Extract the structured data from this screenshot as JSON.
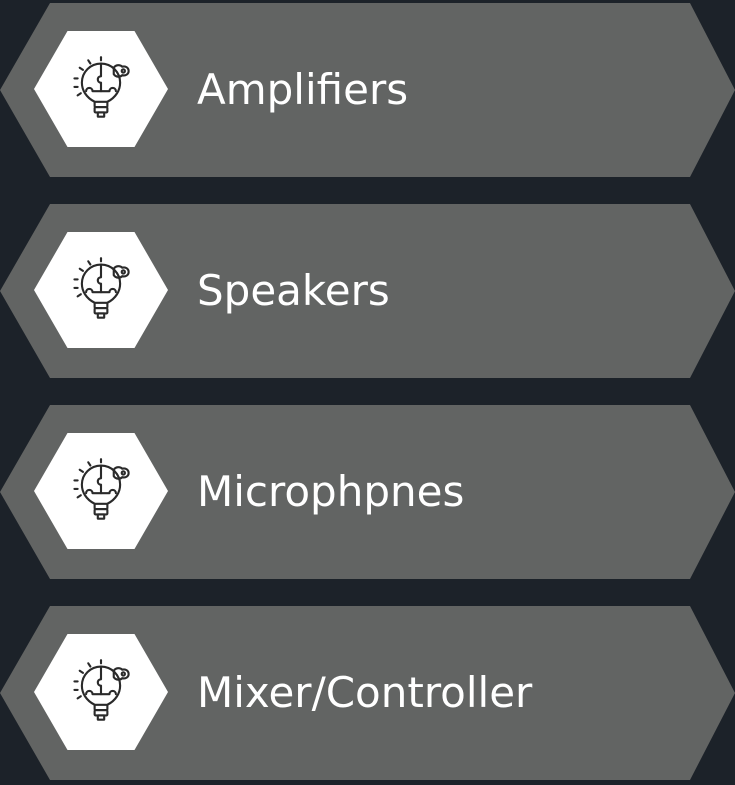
{
  "colors": {
    "background": "#1c2229",
    "panel": "#626463",
    "panel_edge": "#4f5250",
    "hex": "#ffffff",
    "icon": "#2a2a2a",
    "text": "#ffffff"
  },
  "items": [
    {
      "label": "Amplifiers",
      "icon": "lightbulb-puzzle-icon"
    },
    {
      "label": "Speakers",
      "icon": "lightbulb-puzzle-icon"
    },
    {
      "label": "Microphpnes",
      "icon": "lightbulb-puzzle-icon"
    },
    {
      "label": "Mixer/Controller",
      "icon": "lightbulb-puzzle-icon"
    }
  ]
}
